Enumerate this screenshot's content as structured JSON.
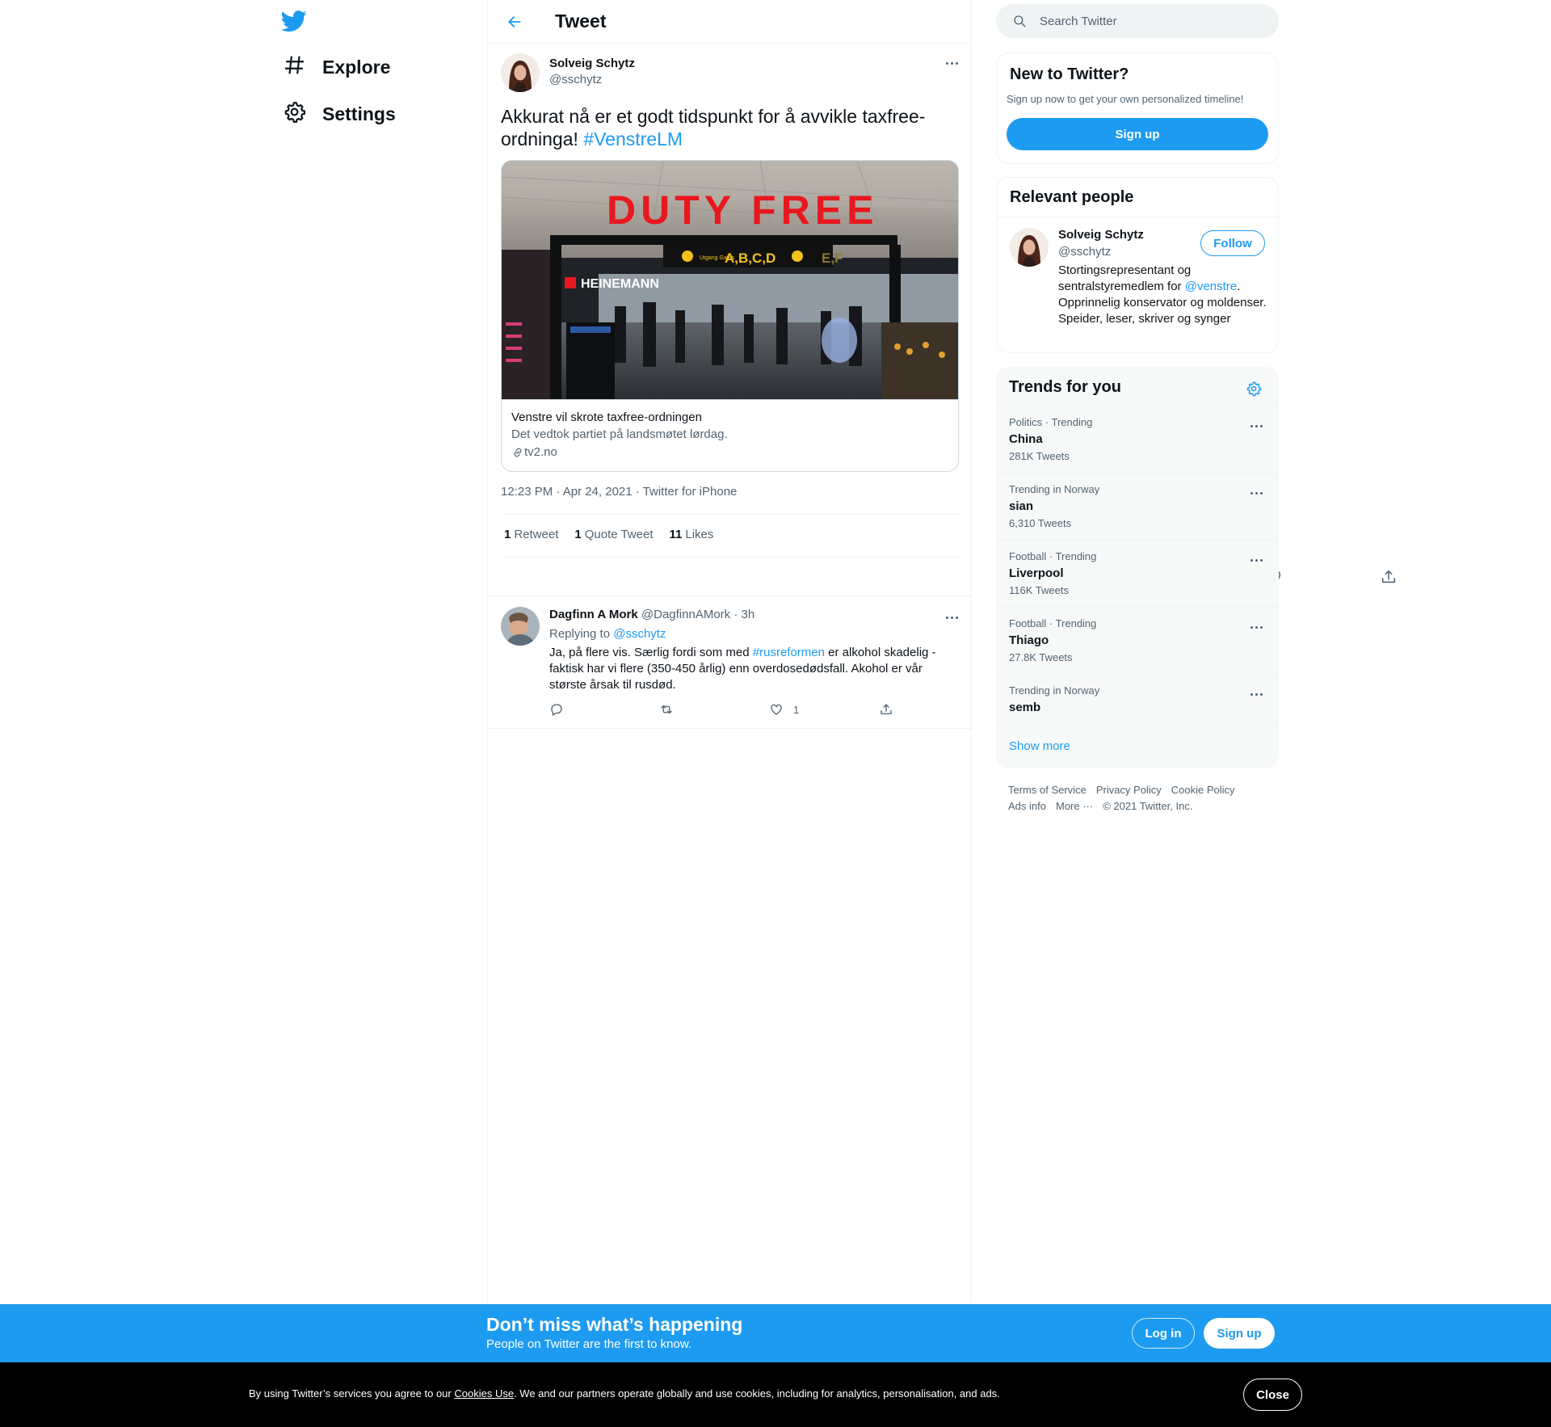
{
  "nav": {
    "explore": "Explore",
    "settings": "Settings"
  },
  "header": {
    "title": "Tweet"
  },
  "tweet": {
    "author_name": "Solveig Schytz",
    "author_handle": "@sschytz",
    "text": "Akkurat nå er et godt tidspunkt for å avvikle taxfree-ordninga! ",
    "hashtag": "#VenstreLM",
    "card": {
      "image_text": "DUTY FREE",
      "sign_gates_1": "A,B,C,D",
      "sign_gates_2": "E,F",
      "sign_small": "Utgang Gates",
      "store": "HEINEMANN",
      "title": "Venstre vil skrote taxfree-ordningen",
      "description": "Det vedtok partiet på landsmøtet lørdag.",
      "domain": "tv2.no"
    },
    "meta": "12:23 PM · Apr 24, 2021 · Twitter for iPhone",
    "stats": {
      "retweets_count": "1",
      "retweets_label": "Retweet",
      "quotes_count": "1",
      "quotes_label": "Quote Tweet",
      "likes_count": "11",
      "likes_label": "Likes"
    }
  },
  "reply": {
    "name": "Dagfinn A Mork",
    "handle_time": "@DagfinnAMork · 3h",
    "replying_prefix": "Replying to ",
    "replying_to": "@sschytz",
    "text_before": "Ja, på flere vis. Særlig fordi som med ",
    "hashtag": "#rusreformen",
    "text_after": " er alkohol skadelig - faktisk har vi flere (350-450 årlig) enn overdosedødsfall.  Akohol er vår største årsak til rusdød.",
    "like_count": "1"
  },
  "search": {
    "placeholder": "Search Twitter"
  },
  "new_to_twitter": {
    "title": "New to Twitter?",
    "subtitle": "Sign up now to get your own personalized timeline!",
    "signup": "Sign up"
  },
  "relevant_people": {
    "title": "Relevant people",
    "name": "Solveig Schytz",
    "handle": "@sschytz",
    "follow": "Follow",
    "bio_before": "Stortingsrepresentant og sentralstyremedlem for ",
    "bio_link": "@venstre",
    "bio_after": ". Opprinnelig konservator og moldenser. Speider, leser, skriver og synger"
  },
  "trends": {
    "title": "Trends for you",
    "items": [
      {
        "context": "Politics · Trending",
        "name": "China",
        "count": "281K Tweets"
      },
      {
        "context": "Trending in Norway",
        "name": "sian",
        "count": "6,310 Tweets"
      },
      {
        "context": "Football · Trending",
        "name": "Liverpool",
        "count": "116K Tweets"
      },
      {
        "context": "Football · Trending",
        "name": "Thiago",
        "count": "27.8K Tweets"
      },
      {
        "context": "Trending in Norway",
        "name": "semb",
        "count": ""
      }
    ],
    "show_more": "Show more"
  },
  "footer": {
    "terms": "Terms of Service",
    "privacy": "Privacy Policy",
    "cookie": "Cookie Policy",
    "ads": "Ads info",
    "more": "More ···",
    "copyright": "© 2021 Twitter, Inc."
  },
  "banner": {
    "title": "Don’t miss what’s happening",
    "subtitle": "People on Twitter are the first to know.",
    "login": "Log in",
    "signup": "Sign up"
  },
  "cookie": {
    "before": "By using Twitter’s services you agree to our ",
    "link": "Cookies Use",
    "after": ". We and our partners operate globally and use cookies, including for analytics, personalisation, and ads.",
    "close": "Close"
  },
  "colors": {
    "accent": "#1d9bf0",
    "text": "#0f1419",
    "muted": "#536471",
    "border": "#eff3f4",
    "cookie_bg": "#000000"
  }
}
